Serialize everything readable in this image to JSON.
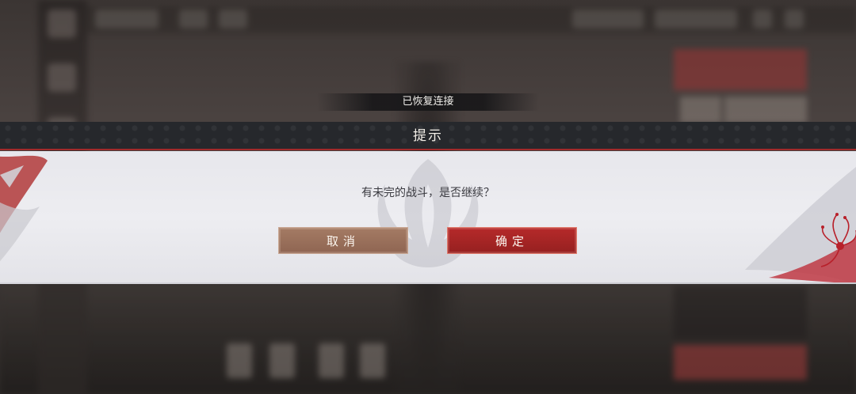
{
  "toast": {
    "text": "已恢复连接"
  },
  "dialog": {
    "title": "提示",
    "message": "有未完的战斗，是否继续？",
    "cancel_label": "取消",
    "confirm_label": "确定"
  },
  "colors": {
    "header_bg": "#26282c",
    "body_bg": "#ececf0",
    "accent_red": "#a12a2a",
    "cancel_button": "#9b725d",
    "confirm_button": "#a82424"
  },
  "icons": {
    "emblem": "faded-crest-emblem",
    "decoration_right": "red-spider-lily-flower"
  }
}
